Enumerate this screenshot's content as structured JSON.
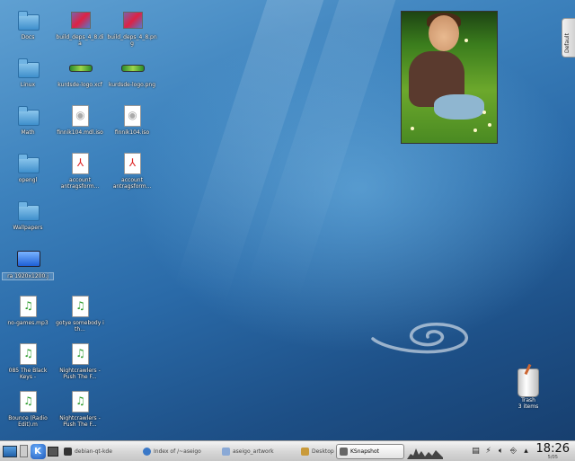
{
  "desktop": {
    "icons": [
      {
        "label": "Docs",
        "kind": "folder"
      },
      {
        "label": "Linux",
        "kind": "folder"
      },
      {
        "label": "Math",
        "kind": "folder"
      },
      {
        "label": "opengl",
        "kind": "folder"
      },
      {
        "label": "Wallpapers",
        "kind": "folder"
      },
      {
        "label": "ra 1920x1200.j",
        "kind": "image-file"
      },
      {
        "label": "no-games.mp3",
        "kind": "audio"
      },
      {
        "label": "085 The Black Keys -",
        "kind": "audio"
      },
      {
        "label": "Bounce (Radio Edit).m",
        "kind": "audio"
      },
      {
        "label": "build_deps_4_8.dia",
        "kind": "diagram"
      },
      {
        "label": "kurdsde-logo.xcf",
        "kind": "xcf"
      },
      {
        "label": "finnik104.mdl.iso",
        "kind": "disc"
      },
      {
        "label": "account antragsform...",
        "kind": "pdf"
      },
      {
        "label": "gotye somebody i th...",
        "kind": "audio"
      },
      {
        "label": "Nightcrawlers - Push The F...",
        "kind": "audio"
      },
      {
        "label": "Nightcrawlers - Push The F...",
        "kind": "audio"
      },
      {
        "label": "build_deps_4_8.png",
        "kind": "diagram"
      },
      {
        "label": "kurdsde-logo.png",
        "kind": "xcf"
      },
      {
        "label": "finnik104.iso",
        "kind": "disc"
      },
      {
        "label": "account antragsform...",
        "kind": "pdf"
      }
    ],
    "default_tab": "Default",
    "trash": {
      "label": "Trash",
      "sublabel": "3 items"
    }
  },
  "taskbar": {
    "tasks": [
      {
        "label": "debian-qt-kde",
        "active": false
      },
      {
        "label": "Index of /~aseigo",
        "active": false
      },
      {
        "label": "aseigo_artwork",
        "active": false
      },
      {
        "label": "Desktop",
        "active": false
      },
      {
        "label": "KSnapshot",
        "active": true
      }
    ],
    "clock": {
      "time": "18:26",
      "date": "5/05"
    }
  },
  "colors": {
    "taskbar": "#d8d8d8",
    "desktop": "#2a6aa8",
    "kde_blue": "#2c7ad6"
  }
}
